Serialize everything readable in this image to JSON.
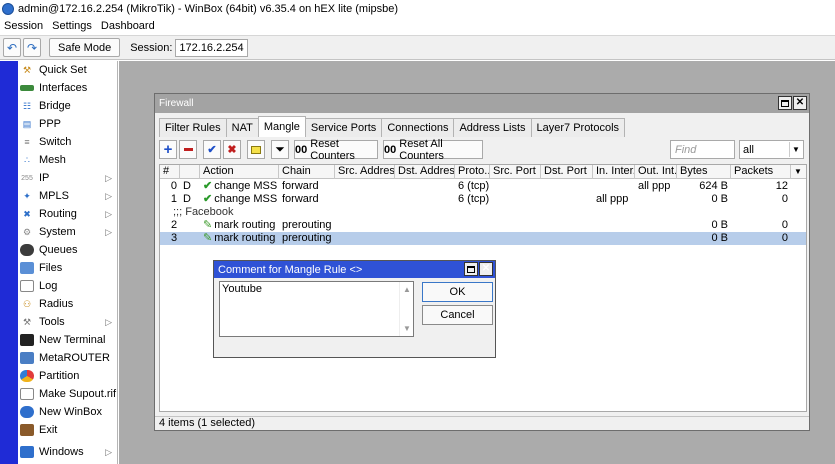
{
  "window": {
    "title": "admin@172.16.2.254 (MikroTik) - WinBox (64bit) v6.35.4 on hEX lite (mipsbe)"
  },
  "menubar": [
    "Session",
    "Settings",
    "Dashboard"
  ],
  "toolbar": {
    "undo_icon": "undo-icon",
    "redo_icon": "redo-icon",
    "safe_mode": "Safe Mode",
    "session_label": "Session:",
    "session_value": "172.16.2.254"
  },
  "sidebar": {
    "items": [
      {
        "label": "Quick Set",
        "icon": "quick-set-icon",
        "submenu": false
      },
      {
        "label": "Interfaces",
        "icon": "interfaces-icon",
        "submenu": false
      },
      {
        "label": "Bridge",
        "icon": "bridge-icon",
        "submenu": false
      },
      {
        "label": "PPP",
        "icon": "ppp-icon",
        "submenu": false
      },
      {
        "label": "Switch",
        "icon": "switch-icon",
        "submenu": false
      },
      {
        "label": "Mesh",
        "icon": "mesh-icon",
        "submenu": false
      },
      {
        "label": "IP",
        "icon": "ip-icon",
        "submenu": true
      },
      {
        "label": "MPLS",
        "icon": "mpls-icon",
        "submenu": true
      },
      {
        "label": "Routing",
        "icon": "routing-icon",
        "submenu": true
      },
      {
        "label": "System",
        "icon": "system-icon",
        "submenu": true
      },
      {
        "label": "Queues",
        "icon": "queues-icon",
        "submenu": false
      },
      {
        "label": "Files",
        "icon": "files-icon",
        "submenu": false
      },
      {
        "label": "Log",
        "icon": "log-icon",
        "submenu": false
      },
      {
        "label": "Radius",
        "icon": "radius-icon",
        "submenu": false
      },
      {
        "label": "Tools",
        "icon": "tools-icon",
        "submenu": true
      },
      {
        "label": "New Terminal",
        "icon": "terminal-icon",
        "submenu": false
      },
      {
        "label": "MetaROUTER",
        "icon": "metarouter-icon",
        "submenu": false
      },
      {
        "label": "Partition",
        "icon": "partition-icon",
        "submenu": false
      },
      {
        "label": "Make Supout.rif",
        "icon": "supout-icon",
        "submenu": false
      },
      {
        "label": "New WinBox",
        "icon": "winbox-icon",
        "submenu": false
      },
      {
        "label": "Exit",
        "icon": "exit-icon",
        "submenu": false
      }
    ],
    "windows_item": {
      "label": "Windows",
      "icon": "windows-icon",
      "submenu": true
    },
    "submenu_arrow": "▷"
  },
  "firewall": {
    "title": "Firewall",
    "tabs": [
      "Filter Rules",
      "NAT",
      "Mangle",
      "Service Ports",
      "Connections",
      "Address Lists",
      "Layer7 Protocols"
    ],
    "active_tab": "Mangle",
    "tools": {
      "reset_counters": "Reset Counters",
      "reset_all_counters": "Reset All Counters",
      "counter_prefix": "00",
      "find_placeholder": "Find",
      "filter_value": "all"
    },
    "columns": [
      "#",
      "Action",
      "Chain",
      "Src. Address",
      "Dst. Address",
      "Proto...",
      "Src. Port",
      "Dst. Port",
      "In. Inter...",
      "Out. Int...",
      "Bytes",
      "Packets"
    ],
    "rows": [
      {
        "num": "0",
        "flag": "D",
        "action": "change MSS",
        "chain": "forward",
        "proto": "6 (tcp)",
        "in_iface": "",
        "out_iface": "all ppp",
        "bytes": "624 B",
        "packets": "12",
        "selected": false
      },
      {
        "num": "1",
        "flag": "D",
        "action": "change MSS",
        "chain": "forward",
        "proto": "6 (tcp)",
        "in_iface": "all ppp",
        "out_iface": "",
        "bytes": "0 B",
        "packets": "0",
        "selected": false
      },
      {
        "comment": ";;; Facebook"
      },
      {
        "num": "2",
        "flag": "",
        "action": "mark routing",
        "chain": "prerouting",
        "proto": "",
        "in_iface": "",
        "out_iface": "",
        "bytes": "0 B",
        "packets": "0",
        "selected": false
      },
      {
        "num": "3",
        "flag": "",
        "action": "mark routing",
        "chain": "prerouting",
        "proto": "",
        "in_iface": "",
        "out_iface": "",
        "bytes": "0 B",
        "packets": "0",
        "selected": true
      }
    ],
    "status": "4 items (1 selected)"
  },
  "comment_dialog": {
    "title": "Comment for Mangle Rule <>",
    "text": "Youtube",
    "ok": "OK",
    "cancel": "Cancel"
  }
}
